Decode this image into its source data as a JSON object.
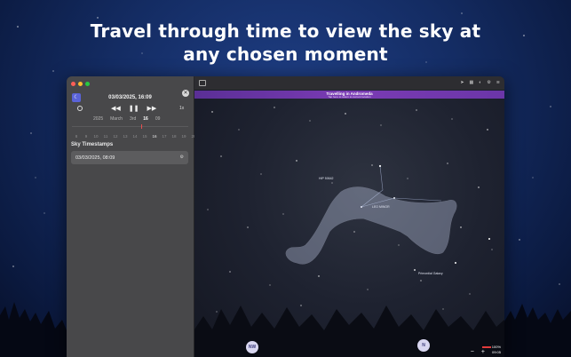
{
  "headline": {
    "line1": "Travel through time to view the sky at",
    "line2": "any chosen moment"
  },
  "sidebar": {
    "datetime": "03/03/2025, 16:09",
    "controls": {
      "rewind": "◀◀",
      "pause": "❚❚",
      "forward": "▶▶",
      "speed": "1x"
    },
    "picker": {
      "year": "2025",
      "month": "March",
      "day": "3rd",
      "hour": "16",
      "minute": "09"
    },
    "numbers": [
      "8",
      "9",
      "10",
      "11",
      "12",
      "13",
      "14",
      "15",
      "16",
      "17",
      "18",
      "19",
      "20"
    ],
    "section_title": "Sky Timestamps",
    "timestamp": "03/03/2025, 08:09",
    "timestamp_icon": "gear-icon"
  },
  "sky": {
    "banner_title": "Travelling in Andromeda",
    "banner_sub": "Tap here to return to current location",
    "label_hip": "HIP 50642",
    "label_constellation": "LEO MINOR",
    "label_extra": "Primordial Galaxy",
    "compass_left": "NW",
    "compass_right": "N",
    "hud_top": "100%",
    "hud_bottom": "09:05",
    "zoom_minus": "−",
    "zoom_plus": "+"
  }
}
